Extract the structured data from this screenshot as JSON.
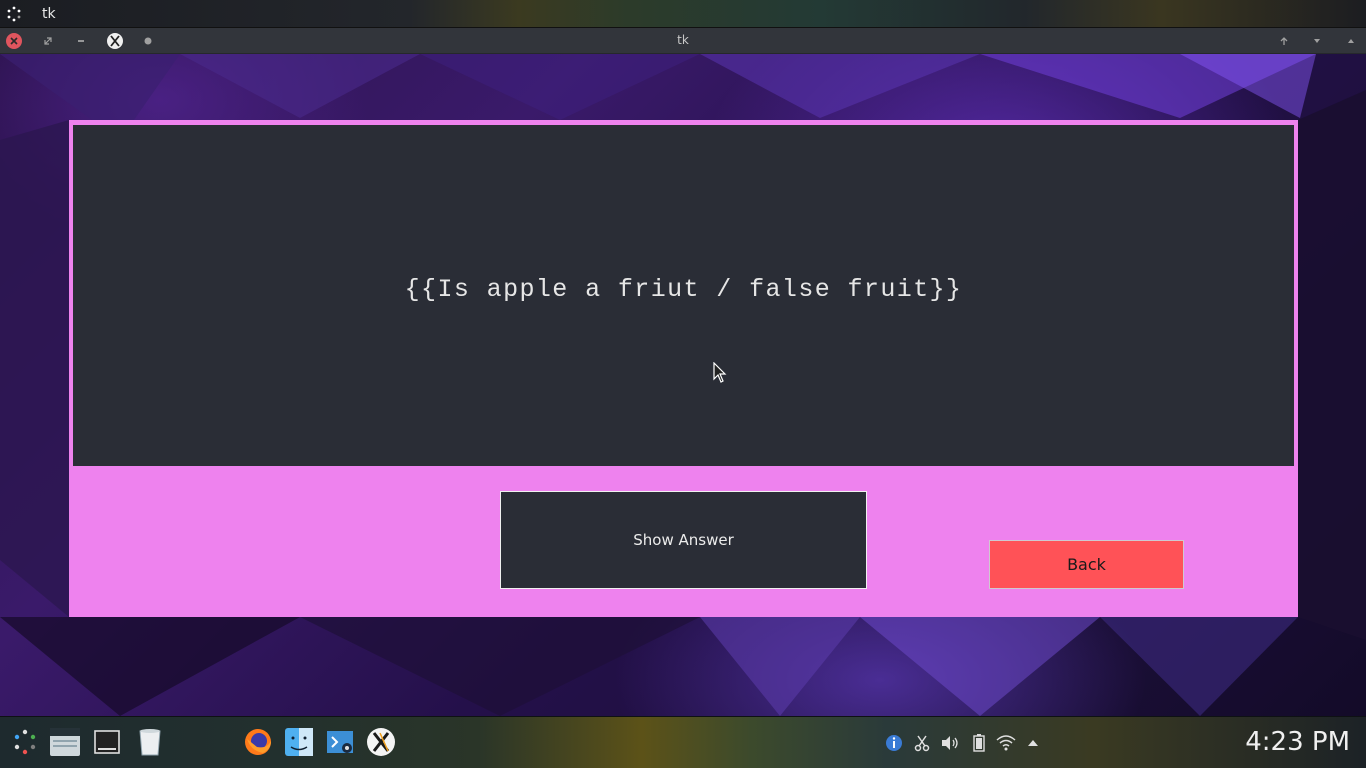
{
  "top_panel": {
    "app_title": "tk"
  },
  "window": {
    "title": "tk"
  },
  "card": {
    "text": "{{Is apple a friut / false fruit}}"
  },
  "buttons": {
    "show_answer": "Show Answer",
    "back": "Back"
  },
  "taskbar": {
    "clock": "4:23 PM"
  },
  "colors": {
    "frame_bg": "#ee82ee",
    "card_bg": "#2a2d36",
    "back_button": "#ff5257"
  },
  "icons": {
    "launcher": "launcher-icon",
    "taskbar": [
      "app-menu-icon",
      "file-manager-icon",
      "terminal-icon",
      "trash-icon",
      "firefox-icon",
      "finder-icon",
      "vscode-icon",
      "x-app-icon"
    ],
    "tray": [
      "info-icon",
      "scissors-icon",
      "volume-icon",
      "battery-icon",
      "wifi-icon",
      "tray-expand-icon"
    ]
  }
}
